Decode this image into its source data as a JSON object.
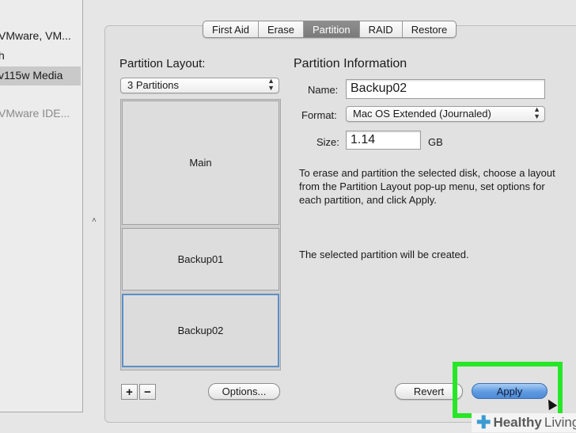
{
  "sidebar": {
    "items": [
      {
        "label": "VMware, VM..."
      },
      {
        "label": "h"
      },
      {
        "label": "v115w Media"
      },
      {
        "label": "VMware IDE..."
      }
    ]
  },
  "tabs": [
    "First Aid",
    "Erase",
    "Partition",
    "RAID",
    "Restore"
  ],
  "active_tab": "Partition",
  "layout": {
    "heading": "Partition Layout:",
    "selected": "3 Partitions",
    "partitions": [
      "Main",
      "Backup01",
      "Backup02"
    ],
    "selected_partition": "Backup02",
    "add_label": "+",
    "remove_label": "−",
    "options_label": "Options..."
  },
  "info": {
    "heading": "Partition Information",
    "name_label": "Name:",
    "name_value": "Backup02",
    "format_label": "Format:",
    "format_value": "Mac OS Extended (Journaled)",
    "size_label": "Size:",
    "size_value": "1.14",
    "size_unit": "GB",
    "description": "To erase and partition the selected disk, choose a layout from the Partition Layout pop-up menu, set options for each partition, and click Apply.",
    "status": "The selected partition will be created."
  },
  "buttons": {
    "revert": "Revert",
    "apply": "Apply"
  },
  "watermark": {
    "text": "Healthy",
    "text2": "Living",
    "brand_color": "#3a9bd1"
  },
  "highlight_color": "#27e627"
}
